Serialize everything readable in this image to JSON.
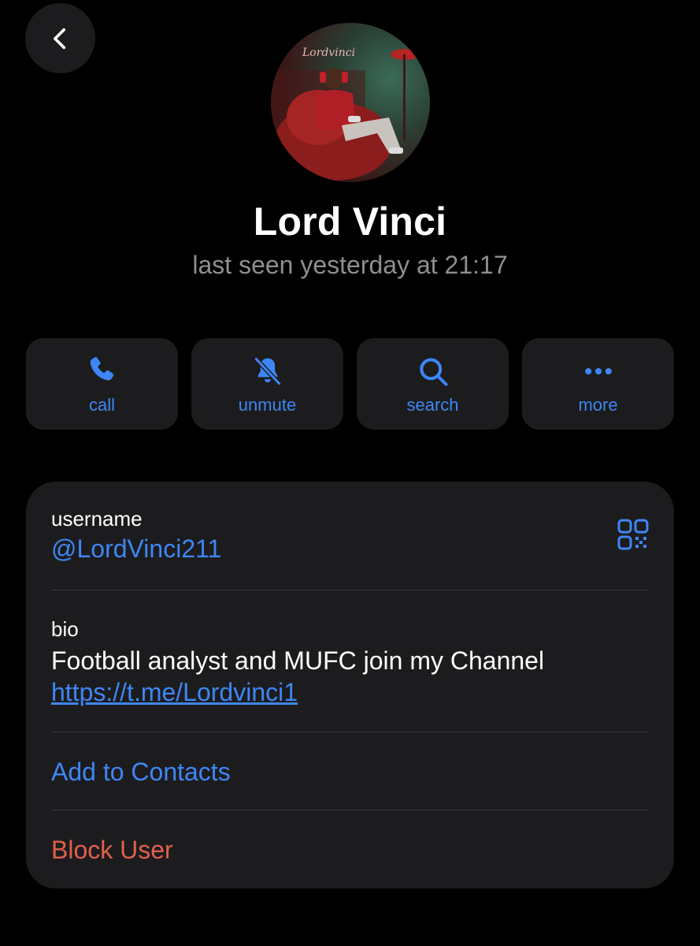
{
  "profile": {
    "name": "Lord Vinci",
    "status": "last seen yesterday at 21:17",
    "avatar_sign_text": "Lordvinci"
  },
  "actions": [
    {
      "label": "call",
      "icon": "phone-icon"
    },
    {
      "label": "unmute",
      "icon": "bell-slash-icon"
    },
    {
      "label": "search",
      "icon": "magnifier-icon"
    },
    {
      "label": "more",
      "icon": "ellipsis-icon"
    }
  ],
  "info": {
    "username_label": "username",
    "username_value": "@LordVinci211",
    "bio_label": "bio",
    "bio_text": "Football analyst and MUFC join my Channel",
    "bio_link": "https://t.me/Lordvinci1",
    "add_contacts_label": "Add to Contacts",
    "block_label": "Block User"
  },
  "colors": {
    "accent": "#3e86f5",
    "destructive": "#e0604a",
    "card_bg": "#1c1c1e",
    "secondary_text": "#8e8e93"
  }
}
